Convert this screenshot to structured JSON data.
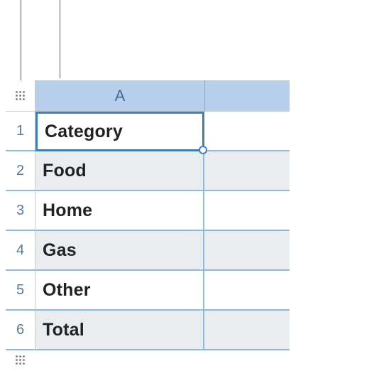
{
  "columns": {
    "a": {
      "label": "A"
    }
  },
  "rows": [
    {
      "num": "1",
      "a": "Category",
      "alt": false
    },
    {
      "num": "2",
      "a": "Food",
      "alt": true
    },
    {
      "num": "3",
      "a": "Home",
      "alt": false
    },
    {
      "num": "4",
      "a": "Gas",
      "alt": true
    },
    {
      "num": "5",
      "a": "Other",
      "alt": false
    },
    {
      "num": "6",
      "a": "Total",
      "alt": true
    }
  ],
  "selection": {
    "cell": "A1"
  }
}
